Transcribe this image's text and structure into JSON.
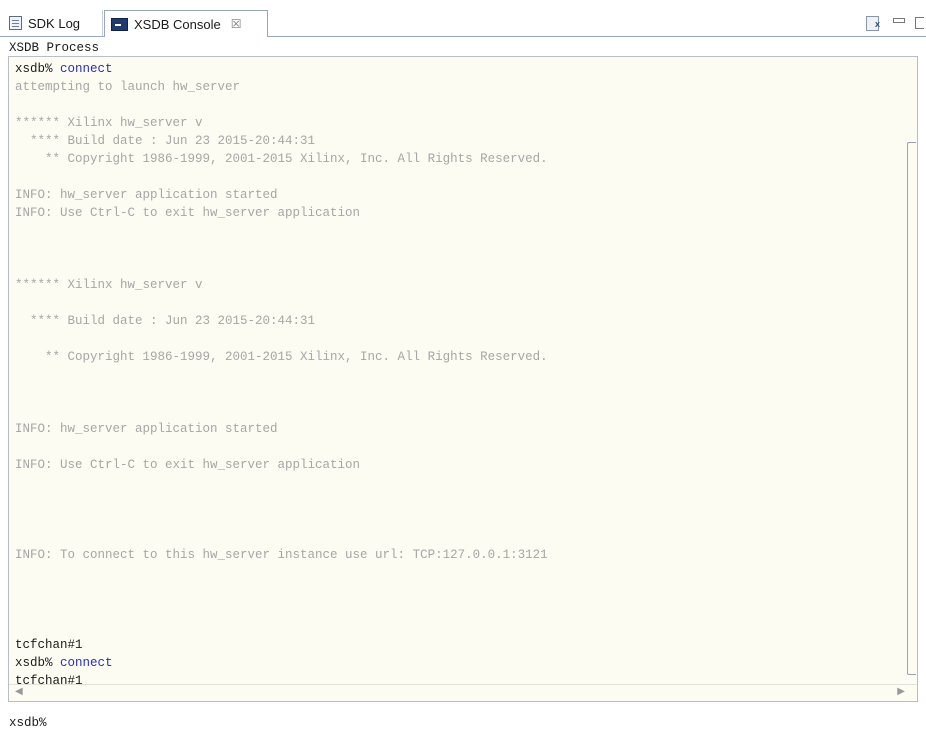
{
  "tabs": [
    {
      "label": "SDK Log",
      "icon": "log-icon"
    },
    {
      "label": "XSDB Console",
      "icon": "console-icon",
      "close": "☒"
    }
  ],
  "toolbar_icons": [
    "pin-console-icon",
    "minimize-icon",
    "maximize-icon"
  ],
  "process_label": "XSDB Process",
  "console_lines": [
    {
      "segments": [
        {
          "text": "xsdb% ",
          "color": "dark"
        },
        {
          "text": "connect",
          "color": "blue"
        }
      ]
    },
    {
      "segments": [
        {
          "text": "attempting to launch hw_server",
          "color": "grey"
        }
      ]
    },
    {
      "segments": [
        {
          "text": "",
          "color": "grey"
        }
      ]
    },
    {
      "segments": [
        {
          "text": "****** Xilinx hw_server v",
          "color": "grey"
        }
      ]
    },
    {
      "segments": [
        {
          "text": "  **** Build date : Jun 23 2015-20:44:31",
          "color": "grey"
        }
      ]
    },
    {
      "segments": [
        {
          "text": "    ** Copyright 1986-1999, 2001-2015 Xilinx, Inc. All Rights Reserved.",
          "color": "grey"
        }
      ]
    },
    {
      "segments": [
        {
          "text": "",
          "color": "grey"
        }
      ]
    },
    {
      "segments": [
        {
          "text": "INFO: hw_server application started",
          "color": "grey"
        }
      ]
    },
    {
      "segments": [
        {
          "text": "INFO: Use Ctrl-C to exit hw_server application",
          "color": "grey"
        }
      ]
    },
    {
      "segments": [
        {
          "text": "",
          "color": "grey"
        }
      ]
    },
    {
      "segments": [
        {
          "text": "",
          "color": "grey"
        }
      ]
    },
    {
      "segments": [
        {
          "text": "",
          "color": "grey"
        }
      ]
    },
    {
      "segments": [
        {
          "text": "****** Xilinx hw_server v",
          "color": "grey"
        }
      ]
    },
    {
      "segments": [
        {
          "text": "",
          "color": "grey"
        }
      ]
    },
    {
      "segments": [
        {
          "text": "  **** Build date : Jun 23 2015-20:44:31",
          "color": "grey"
        }
      ]
    },
    {
      "segments": [
        {
          "text": "",
          "color": "grey"
        }
      ]
    },
    {
      "segments": [
        {
          "text": "    ** Copyright 1986-1999, 2001-2015 Xilinx, Inc. All Rights Reserved.",
          "color": "grey"
        }
      ]
    },
    {
      "segments": [
        {
          "text": "",
          "color": "grey"
        }
      ]
    },
    {
      "segments": [
        {
          "text": "",
          "color": "grey"
        }
      ]
    },
    {
      "segments": [
        {
          "text": "",
          "color": "grey"
        }
      ]
    },
    {
      "segments": [
        {
          "text": "INFO: hw_server application started",
          "color": "grey"
        }
      ]
    },
    {
      "segments": [
        {
          "text": "",
          "color": "grey"
        }
      ]
    },
    {
      "segments": [
        {
          "text": "INFO: Use Ctrl-C to exit hw_server application",
          "color": "grey"
        }
      ]
    },
    {
      "segments": [
        {
          "text": "",
          "color": "grey"
        }
      ]
    },
    {
      "segments": [
        {
          "text": "",
          "color": "grey"
        }
      ]
    },
    {
      "segments": [
        {
          "text": "",
          "color": "grey"
        }
      ]
    },
    {
      "segments": [
        {
          "text": "",
          "color": "grey"
        }
      ]
    },
    {
      "segments": [
        {
          "text": "INFO: To connect to this hw_server instance use url: TCP:127.0.0.1:3121",
          "color": "grey"
        }
      ]
    },
    {
      "segments": [
        {
          "text": "",
          "color": "grey"
        }
      ]
    },
    {
      "segments": [
        {
          "text": "",
          "color": "grey"
        }
      ]
    },
    {
      "segments": [
        {
          "text": "",
          "color": "grey"
        }
      ]
    },
    {
      "segments": [
        {
          "text": "",
          "color": "grey"
        }
      ]
    },
    {
      "segments": [
        {
          "text": "tcfchan#1",
          "color": "dark"
        }
      ]
    },
    {
      "segments": [
        {
          "text": "xsdb% ",
          "color": "dark"
        },
        {
          "text": "connect",
          "color": "blue"
        }
      ]
    },
    {
      "segments": [
        {
          "text": "tcfchan#1",
          "color": "dark"
        }
      ]
    },
    {
      "segments": [
        {
          "text": "xsdb%",
          "color": "dark"
        }
      ]
    }
  ],
  "bottom_prompt": "xsdb%",
  "colors": {
    "console_bg": "#fdfcf3",
    "dark": "#1a1a1a",
    "grey": "#a6a6a6",
    "blue": "#2a2fb8"
  }
}
